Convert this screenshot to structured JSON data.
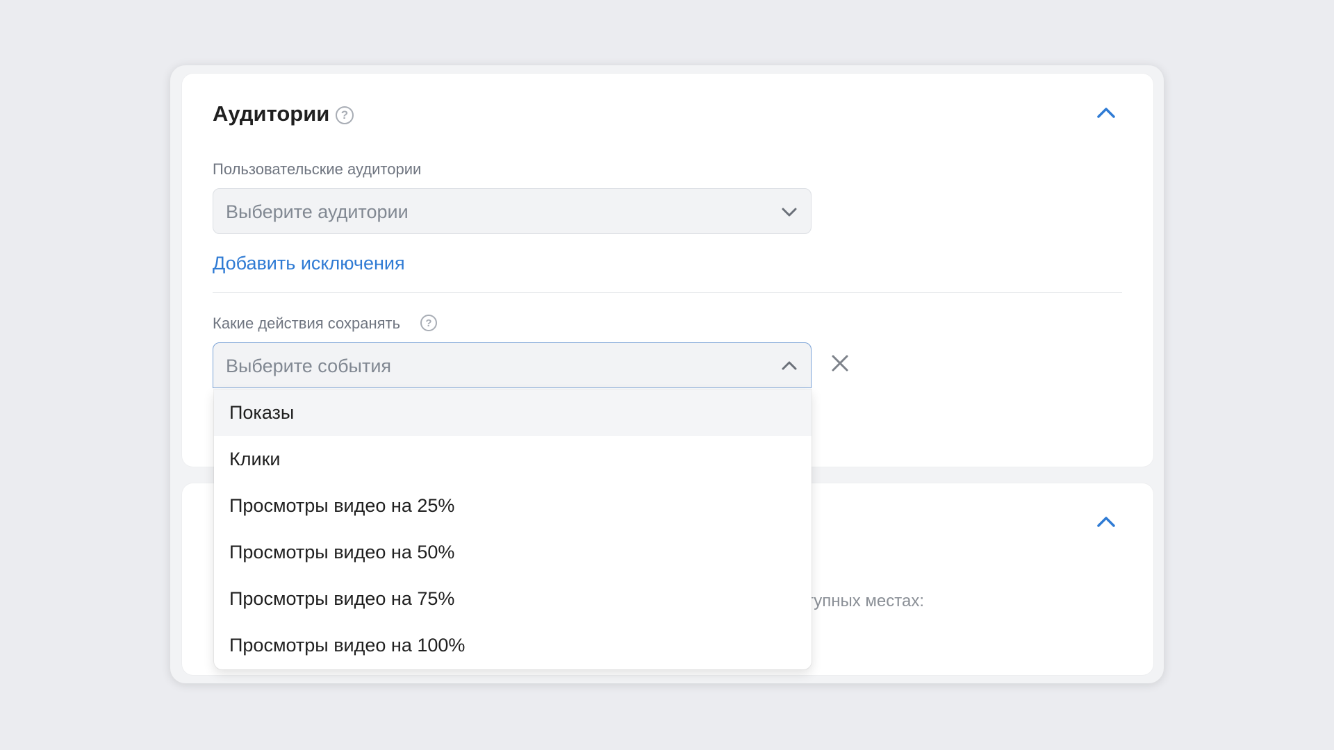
{
  "audiences": {
    "title": "Аудитории",
    "help_icon": "question-circle-icon",
    "collapse_icon": "chevron-up-icon",
    "custom_label": "Пользовательские аудитории",
    "custom_placeholder": "Выберите аудитории",
    "add_exclusions": "Добавить исключения",
    "actions_label": "Какие действия сохранять",
    "events_placeholder": "Выберите события",
    "clear_icon": "close-icon"
  },
  "events_dropdown": {
    "options": [
      {
        "label": "Показы",
        "highlighted": true
      },
      {
        "label": "Клики",
        "highlighted": false
      },
      {
        "label": "Просмотры видео на 25%",
        "highlighted": false
      },
      {
        "label": "Просмотры видео на 50%",
        "highlighted": false
      },
      {
        "label": "Просмотры видео на 75%",
        "highlighted": false
      },
      {
        "label": "Просмотры видео на 100%",
        "highlighted": false
      }
    ]
  },
  "second_section": {
    "partial_text": "тупных местах:",
    "collapse_icon": "chevron-up-icon"
  },
  "colors": {
    "accent": "#2f7bd4",
    "background": "#ebecf0",
    "card": "#ffffff"
  }
}
